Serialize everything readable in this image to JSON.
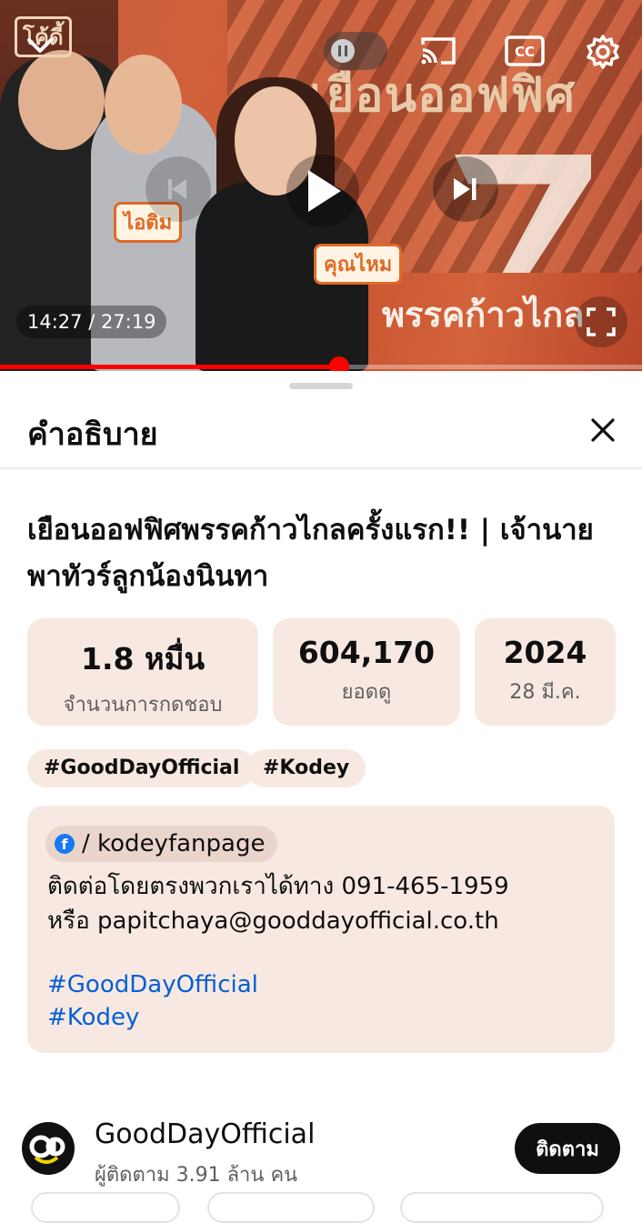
{
  "player": {
    "overlay_title": "เยือนออฟฟิศ",
    "overlay_party": "พรรคก้าวไกล",
    "tag_left": "ไอติม",
    "tag_right": "คุณไหม",
    "brand_mark": "โค้ดี้",
    "time": "14:27 / 27:19",
    "progress": 0.528,
    "icons": [
      "chevron-down-icon",
      "pause-icon",
      "cast-icon",
      "cc-icon",
      "settings-gear-icon",
      "previous-icon",
      "play-icon",
      "next-icon",
      "fullscreen-icon"
    ]
  },
  "sheet": {
    "title": "คำอธิบาย",
    "video_title": "เยือนออฟฟิศพรรคก้าวไกลครั้งแรก!! | เจ้านายพาทัวร์ลูกน้องนินทา",
    "stats": [
      {
        "value": "1.8 หมื่น",
        "label": "จำนวนการกดชอบ"
      },
      {
        "value": "604,170",
        "label": "ยอดดู"
      },
      {
        "value": "2024",
        "label": "28 มี.ค."
      }
    ],
    "chips": [
      "#GoodDayOfficial",
      "#Kodey"
    ],
    "description": {
      "facebook_link": "/ kodeyfanpage",
      "line1": "ติดต่อโดยตรงพวกเราได้ทาง 091-465-1959",
      "line2": "หรือ papitchaya@gooddayofficial.co.th",
      "hashtags": [
        "#GoodDayOfficial",
        "#Kodey"
      ]
    },
    "channel": {
      "name": "GoodDayOfficial",
      "subscribers": "ผู้ติดตาม 3.91 ล้าน คน",
      "subscribe_label": "ติดตาม"
    }
  },
  "colors": {
    "accent_red": "#ff0000",
    "card_bg": "#f7e9e2",
    "link_blue": "#065fd4",
    "facebook_blue": "#1877f2"
  }
}
